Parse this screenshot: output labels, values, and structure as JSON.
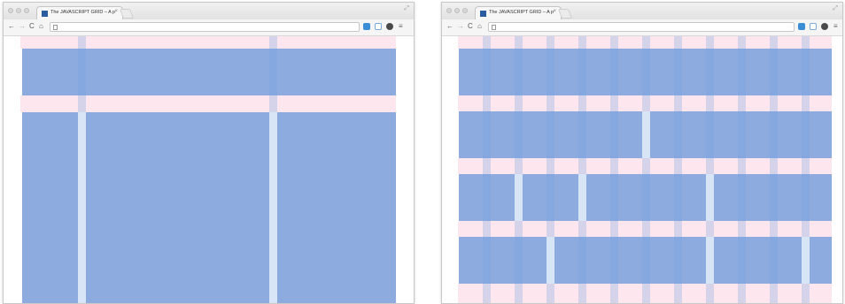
{
  "colors": {
    "block": "#8eabe0",
    "band": "#fde6ee",
    "column_overlay": "rgba(110,160,225,0.28)",
    "chrome": "#f5f5f5"
  },
  "windows": [
    {
      "tab_title": "The JAVASCRIPT GRID – A p",
      "tab_close": "×",
      "resize_glyph": "⤢",
      "nav": {
        "back": "←",
        "forward": "→",
        "reload": "C",
        "home": "⌂"
      },
      "address_value": "",
      "menu_glyph": "≡",
      "toolbar_icons": [
        "extension-blue-icon",
        "extension-window-icon",
        "settings-gear-icon",
        "menu-icon"
      ]
    },
    {
      "tab_title": "The JAVASCRIPT GRID – A p",
      "tab_close": "×",
      "resize_glyph": "⤢",
      "nav": {
        "back": "←",
        "forward": "→",
        "reload": "C",
        "home": "⌂"
      },
      "address_value": "",
      "menu_glyph": "≡",
      "toolbar_icons": [
        "extension-blue-icon",
        "extension-window-icon",
        "settings-gear-icon",
        "menu-icon"
      ]
    }
  ]
}
